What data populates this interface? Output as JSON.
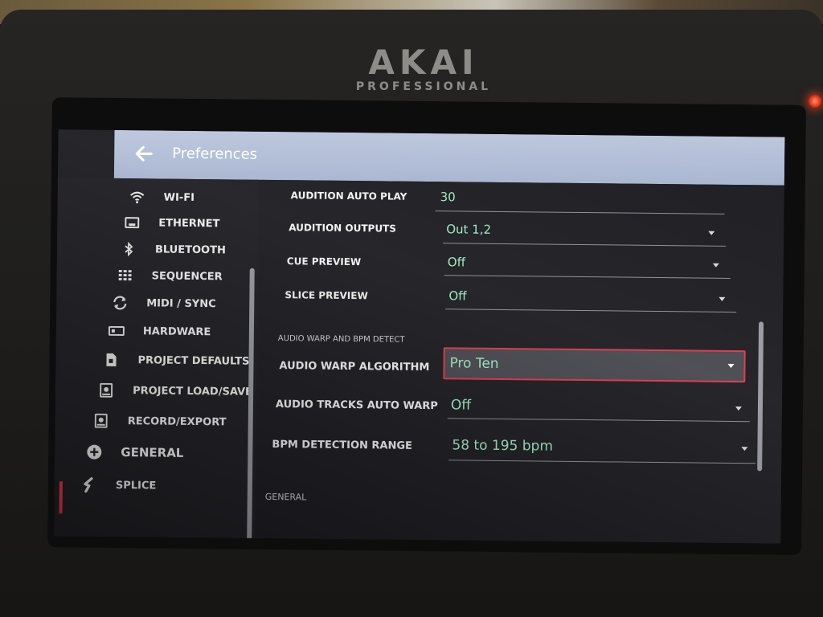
{
  "hardware": {
    "brand": "AKAI",
    "brand_sub": "PROFESSIONAL"
  },
  "header": {
    "back_icon": "arrow-left-icon",
    "title": "Preferences"
  },
  "sidebar": {
    "items": [
      {
        "label": "WI-FI",
        "icon": "wifi-icon"
      },
      {
        "label": "ETHERNET",
        "icon": "ethernet-icon"
      },
      {
        "label": "BLUETOOTH",
        "icon": "bluetooth-icon"
      },
      {
        "label": "SEQUENCER",
        "icon": "grid-icon"
      },
      {
        "label": "MIDI / SYNC",
        "icon": "sync-icon"
      },
      {
        "label": "HARDWARE",
        "icon": "hardware-icon"
      },
      {
        "label": "PROJECT DEFAULTS",
        "icon": "document-icon"
      },
      {
        "label": "PROJECT LOAD/SAVE",
        "icon": "disk-icon"
      },
      {
        "label": "RECORD/EXPORT",
        "icon": "disk-icon"
      },
      {
        "label": "GENERAL",
        "icon": "plus-circle-icon",
        "active": true
      },
      {
        "label": "SPLICE",
        "icon": "splice-icon"
      }
    ]
  },
  "settings": {
    "rows": [
      {
        "label": "AUDITION AUTO PLAY",
        "value": "30"
      },
      {
        "label": "AUDITION OUTPUTS",
        "value": "Out 1,2"
      },
      {
        "label": "CUE PREVIEW",
        "value": "Off"
      },
      {
        "label": "SLICE PREVIEW",
        "value": "Off"
      }
    ],
    "section_warp": "AUDIO WARP AND BPM DETECT",
    "warp_rows": [
      {
        "label": "AUDIO WARP ALGORITHM",
        "value": "Pro Ten",
        "selected": true
      },
      {
        "label": "AUDIO TRACKS AUTO WARP",
        "value": "Off"
      },
      {
        "label": "BPM DETECTION RANGE",
        "value": "58 to 195 bpm"
      }
    ],
    "section_general": "GENERAL"
  },
  "colors": {
    "accent_red": "#e0394a",
    "value_green": "#9fe9c3",
    "titlebar": "#b2bed6",
    "led": "#ff3c1a"
  }
}
